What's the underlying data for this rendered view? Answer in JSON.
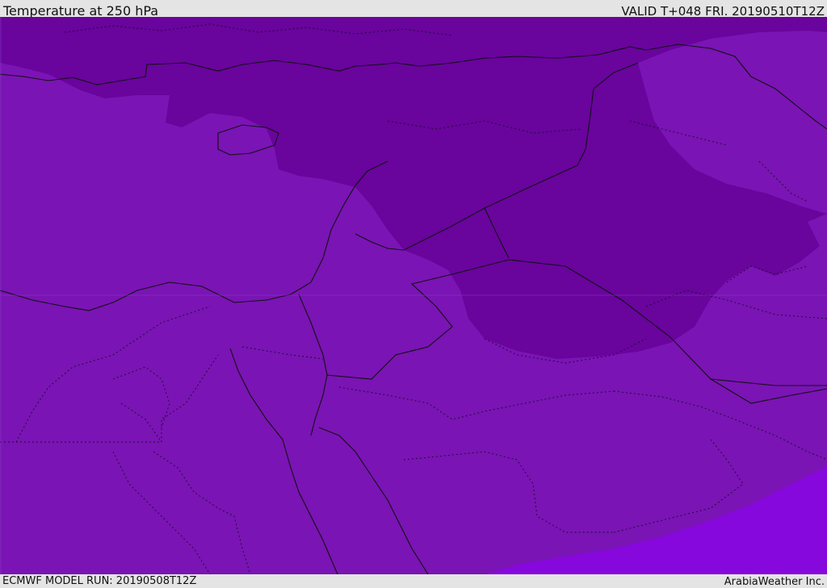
{
  "header": {
    "title": "Temperature at 250 hPa",
    "valid": "VALID T+048 FRI. 20190510T12Z"
  },
  "footer": {
    "model_run": "ECMWF MODEL RUN: 20190508T12Z",
    "credit": "ArabiaWeather Inc."
  },
  "map": {
    "fill_colors": {
      "base": "#7a14b4",
      "cold_band": "#69049d",
      "warm_patch": "#8608dc",
      "border_line": "#111111"
    }
  }
}
